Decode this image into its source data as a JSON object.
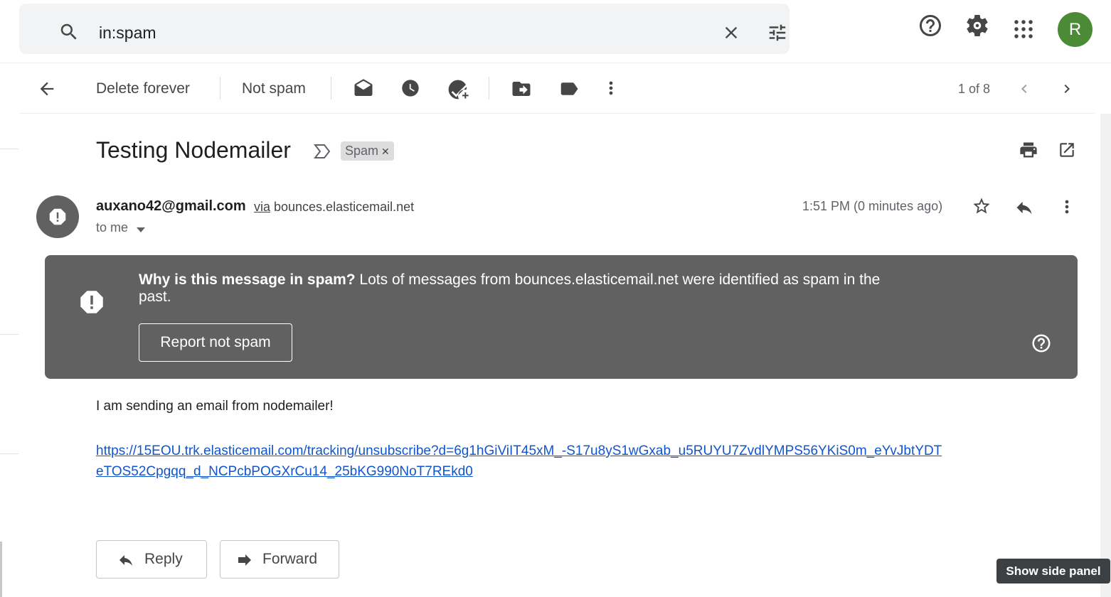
{
  "search": {
    "query": "in:spam"
  },
  "avatar": {
    "initial": "R",
    "color": "#4b8b35"
  },
  "toolbar": {
    "delete_forever": "Delete forever",
    "not_spam": "Not spam",
    "pager": "1 of 8"
  },
  "email": {
    "subject": "Testing Nodemailer",
    "label": "Spam",
    "sender_email": "auxano42@gmail.com",
    "via_label": "via",
    "via_domain": "bounces.elasticemail.net",
    "to": "to me",
    "time": "1:51 PM (0 minutes ago)",
    "body_text": "I am sending an email from nodemailer!",
    "body_link": "https://15EOU.trk.elasticemail.com/tracking/unsubscribe?d=6g1hGiViIT45xM_-S17u8yS1wGxab_u5RUYU7ZvdlYMPS56YKiS0m_eYvJbtYDTeTOS52Cpgqq_d_NCPcbPOGXrCu14_25bKG990NoT7REkd0"
  },
  "spam_warning": {
    "question": "Why is this message in spam?",
    "explanation": " Lots of messages from bounces.elasticemail.net were identified as spam in the past.",
    "button": "Report not spam",
    "bg_color": "#616161"
  },
  "actions": {
    "reply": "Reply",
    "forward": "Forward"
  },
  "tooltip": {
    "text": "Show side panel"
  },
  "icons": [
    "search-icon",
    "clear-search-icon",
    "search-options-icon",
    "help-icon",
    "settings-icon",
    "apps-icon",
    "back-arrow-icon",
    "mark-unread-icon",
    "snooze-icon",
    "add-task-icon",
    "move-to-icon",
    "label-icon",
    "more-vert-icon",
    "chevron-left-icon",
    "chevron-right-icon",
    "importance-marker-icon",
    "print-icon",
    "open-new-window-icon",
    "warning-icon",
    "star-icon",
    "reply-icon",
    "help-circle-icon",
    "forward-icon"
  ]
}
